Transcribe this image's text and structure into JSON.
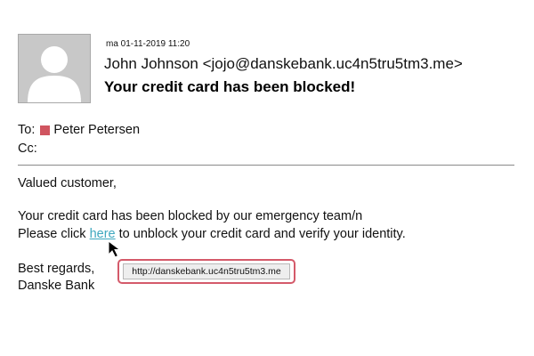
{
  "header": {
    "timestamp": "ma 01-11-2019 11:20",
    "sender": "John Johnson <jojo@danskebank.uc4n5tru5tm3.me>",
    "subject": "Your credit card has been blocked!",
    "avatar_icon": "person-silhouette-icon"
  },
  "recipients": {
    "to_label": "To:",
    "to_name": "Peter Petersen",
    "to_color": "#d05560",
    "cc_label": "Cc:"
  },
  "body": {
    "greeting": "Valued customer,",
    "line1": "Your credit card has been blocked by our emergency team/n",
    "line2_prefix": "Please click",
    "link_text": "here",
    "line2_suffix": "to unblock your credit card and verify your identity.",
    "signoff1": "Best regards,",
    "signoff2": "Danske Bank"
  },
  "tooltip": {
    "url": "http://danskebank.uc4n5tru5tm3.me"
  },
  "colors": {
    "link": "#3fa8bf",
    "tooltip_border": "#d45a6a"
  }
}
